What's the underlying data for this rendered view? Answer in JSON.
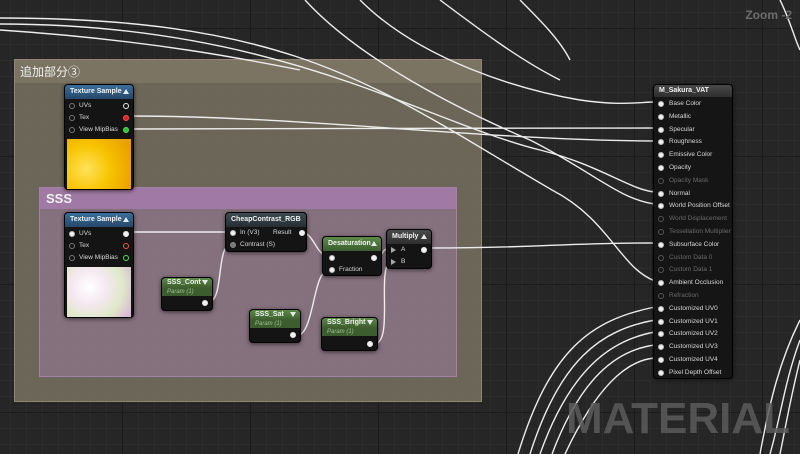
{
  "viewport": {
    "zoom_label": "Zoom -2",
    "watermark": "MATERIAL"
  },
  "comments": {
    "outer_title": "追加部分③",
    "inner_title": "SSS"
  },
  "nodes": {
    "tex1": {
      "title": "Texture Sample",
      "pins": [
        "UVs",
        "Tex",
        "View MipBias"
      ]
    },
    "tex2": {
      "title": "Texture Sample",
      "pins": [
        "UVs",
        "Tex",
        "View MipBias"
      ]
    },
    "contrast": {
      "title": "CheapContrast_RGB",
      "in_pin": "In (V3)",
      "contrast_pin": "Contrast (S)",
      "out_pin": "Result"
    },
    "desat": {
      "title": "Desaturation",
      "fraction_pin": "Fraction"
    },
    "multiply": {
      "title": "Multiply",
      "a_pin": "A",
      "b_pin": "B"
    },
    "sss_cont": {
      "title": "SSS_Cont",
      "subtitle": "Param (1)"
    },
    "sss_sat": {
      "title": "SSS_Sat",
      "subtitle": "Param (1)"
    },
    "sss_bright": {
      "title": "SSS_Bright",
      "subtitle": "Param (1)"
    }
  },
  "material": {
    "title": "M_Sakura_VAT",
    "pins": [
      {
        "label": "Base Color",
        "active": true
      },
      {
        "label": "Metallic",
        "active": true
      },
      {
        "label": "Specular",
        "active": true
      },
      {
        "label": "Roughness",
        "active": true
      },
      {
        "label": "Emissive Color",
        "active": true
      },
      {
        "label": "Opacity",
        "active": true
      },
      {
        "label": "Opacity Mask",
        "active": false
      },
      {
        "label": "Normal",
        "active": true
      },
      {
        "label": "World Position Offset",
        "active": true
      },
      {
        "label": "World Displacement",
        "active": false
      },
      {
        "label": "Tessellation Multiplier",
        "active": false
      },
      {
        "label": "Subsurface Color",
        "active": true
      },
      {
        "label": "Custom Data 0",
        "active": false
      },
      {
        "label": "Custom Data 1",
        "active": false
      },
      {
        "label": "Ambient Occlusion",
        "active": true
      },
      {
        "label": "Refraction",
        "active": false
      },
      {
        "label": "Customized UV0",
        "active": true
      },
      {
        "label": "Customized UV1",
        "active": true
      },
      {
        "label": "Customized UV2",
        "active": true
      },
      {
        "label": "Customized UV3",
        "active": true
      },
      {
        "label": "Customized UV4",
        "active": true
      },
      {
        "label": "Pixel Depth Offset",
        "active": true
      }
    ]
  }
}
